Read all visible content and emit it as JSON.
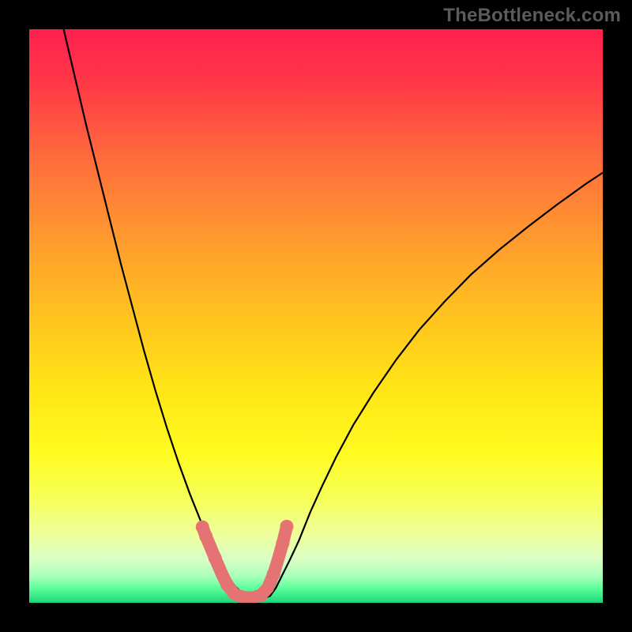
{
  "watermark": "TheBottleneck.com",
  "colors": {
    "frame": "#000000",
    "curve": "#000000",
    "marker": "#e57373",
    "gradient_stops": [
      {
        "o": 0.0,
        "c": "#ff1f4f"
      },
      {
        "o": 0.1,
        "c": "#ff3a46"
      },
      {
        "o": 0.22,
        "c": "#ff6a3d"
      },
      {
        "o": 0.35,
        "c": "#ff9530"
      },
      {
        "o": 0.48,
        "c": "#ffbd22"
      },
      {
        "o": 0.62,
        "c": "#ffe315"
      },
      {
        "o": 0.74,
        "c": "#fffb20"
      },
      {
        "o": 0.82,
        "c": "#f6ff5a"
      },
      {
        "o": 0.885,
        "c": "#edffa0"
      },
      {
        "o": 0.925,
        "c": "#d9ffc4"
      },
      {
        "o": 0.955,
        "c": "#a6ffb8"
      },
      {
        "o": 0.975,
        "c": "#5bff9a"
      },
      {
        "o": 1.0,
        "c": "#1cd67a"
      }
    ]
  },
  "chart_data": {
    "type": "line",
    "title": "",
    "xlabel": "",
    "ylabel": "",
    "xlim": [
      0,
      100
    ],
    "ylim": [
      0,
      100
    ],
    "min_region": {
      "x_start": 32.5,
      "x_end": 41.0,
      "y": 1.0
    },
    "series": [
      {
        "name": "left",
        "x": [
          6,
          8,
          10,
          12,
          14,
          16,
          18,
          20,
          22,
          24,
          26,
          28,
          30,
          31,
          32,
          33,
          33.8,
          34.5,
          35.5,
          36.5,
          38,
          39.5,
          41
        ],
        "y": [
          100,
          91.5,
          83,
          75,
          67,
          59,
          51.5,
          44,
          37,
          30.5,
          24.5,
          19,
          14,
          11.5,
          9.3,
          7.4,
          5.9,
          4.7,
          3.3,
          2.3,
          1.3,
          0.9,
          0.8
        ]
      },
      {
        "name": "right",
        "x": [
          41,
          42,
          43,
          44,
          45.5,
          47,
          49,
          51,
          53.5,
          56.5,
          60,
          64,
          68,
          72.5,
          77,
          82,
          87,
          92,
          97,
          100
        ],
        "y": [
          0.8,
          1.2,
          2.6,
          4.6,
          7.6,
          10.8,
          15.8,
          20.2,
          25.4,
          31.0,
          36.6,
          42.4,
          47.6,
          52.6,
          57.2,
          61.6,
          65.6,
          69.4,
          73.0,
          75.0
        ]
      }
    ],
    "marker_path": {
      "name": "inflection_markers",
      "stroke_width_px": 16,
      "points": [
        {
          "x": 30.2,
          "y": 13.2
        },
        {
          "x": 30.8,
          "y": 11.6
        },
        {
          "x": 31.4,
          "y": 10.2
        },
        {
          "x": 32.4,
          "y": 7.8
        },
        {
          "x": 33.6,
          "y": 5.0
        },
        {
          "x": 34.5,
          "y": 3.2
        },
        {
          "x": 35.8,
          "y": 1.5
        },
        {
          "x": 37.5,
          "y": 0.9
        },
        {
          "x": 39.0,
          "y": 0.9
        },
        {
          "x": 40.4,
          "y": 1.3
        },
        {
          "x": 41.6,
          "y": 2.6
        },
        {
          "x": 42.6,
          "y": 5.0
        },
        {
          "x": 43.4,
          "y": 7.6
        },
        {
          "x": 44.2,
          "y": 10.4
        },
        {
          "x": 44.9,
          "y": 13.3
        }
      ]
    }
  }
}
